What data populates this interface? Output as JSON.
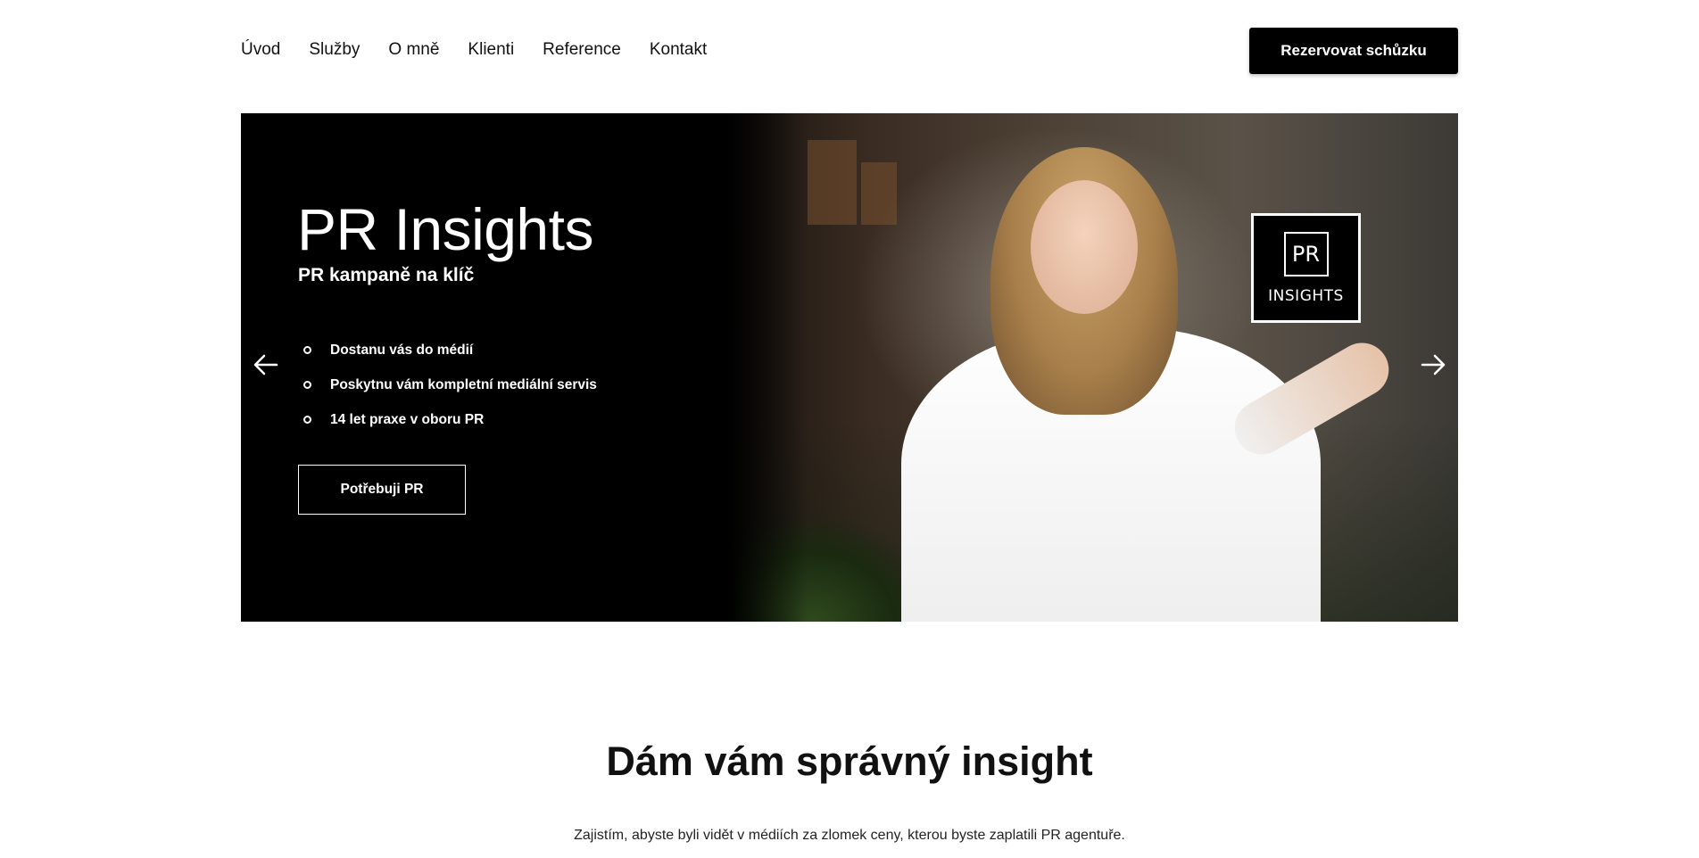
{
  "nav": {
    "links": [
      "Úvod",
      "Služby",
      "O mně",
      "Klienti",
      "Reference",
      "Kontakt"
    ],
    "cta_label": "Rezervovat schůzku"
  },
  "hero": {
    "title": "PR Insights",
    "subtitle": "PR kampaně na klíč",
    "bullets": [
      "Dostanu vás do médií",
      "Poskytnu vám kompletní mediální servis",
      "14 let praxe v oboru PR"
    ],
    "button_label": "Potřebuji PR",
    "logo": {
      "mark": "PR",
      "text": "INSIGHTS"
    },
    "prev_icon": "arrow-left-icon",
    "next_icon": "arrow-right-icon"
  },
  "section": {
    "title": "Dám vám správný insight",
    "text": "Zajistím, abyste byli vidět v médiích za zlomek ceny, kterou byste zaplatili PR agentuře."
  },
  "colors": {
    "accent": "#000000",
    "text": "#111111",
    "background": "#ffffff"
  }
}
